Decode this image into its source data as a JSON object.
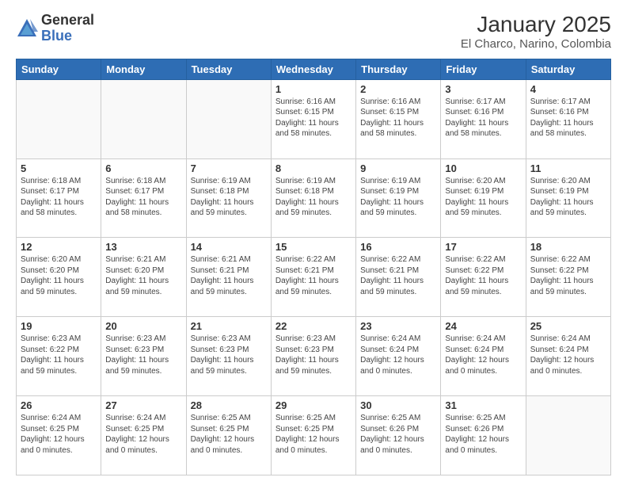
{
  "logo": {
    "general": "General",
    "blue": "Blue"
  },
  "title": "January 2025",
  "subtitle": "El Charco, Narino, Colombia",
  "weekdays": [
    "Sunday",
    "Monday",
    "Tuesday",
    "Wednesday",
    "Thursday",
    "Friday",
    "Saturday"
  ],
  "weeks": [
    [
      {
        "day": "",
        "sunrise": "",
        "sunset": "",
        "daylight": ""
      },
      {
        "day": "",
        "sunrise": "",
        "sunset": "",
        "daylight": ""
      },
      {
        "day": "",
        "sunrise": "",
        "sunset": "",
        "daylight": ""
      },
      {
        "day": "1",
        "sunrise": "Sunrise: 6:16 AM",
        "sunset": "Sunset: 6:15 PM",
        "daylight": "Daylight: 11 hours and 58 minutes."
      },
      {
        "day": "2",
        "sunrise": "Sunrise: 6:16 AM",
        "sunset": "Sunset: 6:15 PM",
        "daylight": "Daylight: 11 hours and 58 minutes."
      },
      {
        "day": "3",
        "sunrise": "Sunrise: 6:17 AM",
        "sunset": "Sunset: 6:16 PM",
        "daylight": "Daylight: 11 hours and 58 minutes."
      },
      {
        "day": "4",
        "sunrise": "Sunrise: 6:17 AM",
        "sunset": "Sunset: 6:16 PM",
        "daylight": "Daylight: 11 hours and 58 minutes."
      }
    ],
    [
      {
        "day": "5",
        "sunrise": "Sunrise: 6:18 AM",
        "sunset": "Sunset: 6:17 PM",
        "daylight": "Daylight: 11 hours and 58 minutes."
      },
      {
        "day": "6",
        "sunrise": "Sunrise: 6:18 AM",
        "sunset": "Sunset: 6:17 PM",
        "daylight": "Daylight: 11 hours and 58 minutes."
      },
      {
        "day": "7",
        "sunrise": "Sunrise: 6:19 AM",
        "sunset": "Sunset: 6:18 PM",
        "daylight": "Daylight: 11 hours and 59 minutes."
      },
      {
        "day": "8",
        "sunrise": "Sunrise: 6:19 AM",
        "sunset": "Sunset: 6:18 PM",
        "daylight": "Daylight: 11 hours and 59 minutes."
      },
      {
        "day": "9",
        "sunrise": "Sunrise: 6:19 AM",
        "sunset": "Sunset: 6:19 PM",
        "daylight": "Daylight: 11 hours and 59 minutes."
      },
      {
        "day": "10",
        "sunrise": "Sunrise: 6:20 AM",
        "sunset": "Sunset: 6:19 PM",
        "daylight": "Daylight: 11 hours and 59 minutes."
      },
      {
        "day": "11",
        "sunrise": "Sunrise: 6:20 AM",
        "sunset": "Sunset: 6:19 PM",
        "daylight": "Daylight: 11 hours and 59 minutes."
      }
    ],
    [
      {
        "day": "12",
        "sunrise": "Sunrise: 6:20 AM",
        "sunset": "Sunset: 6:20 PM",
        "daylight": "Daylight: 11 hours and 59 minutes."
      },
      {
        "day": "13",
        "sunrise": "Sunrise: 6:21 AM",
        "sunset": "Sunset: 6:20 PM",
        "daylight": "Daylight: 11 hours and 59 minutes."
      },
      {
        "day": "14",
        "sunrise": "Sunrise: 6:21 AM",
        "sunset": "Sunset: 6:21 PM",
        "daylight": "Daylight: 11 hours and 59 minutes."
      },
      {
        "day": "15",
        "sunrise": "Sunrise: 6:22 AM",
        "sunset": "Sunset: 6:21 PM",
        "daylight": "Daylight: 11 hours and 59 minutes."
      },
      {
        "day": "16",
        "sunrise": "Sunrise: 6:22 AM",
        "sunset": "Sunset: 6:21 PM",
        "daylight": "Daylight: 11 hours and 59 minutes."
      },
      {
        "day": "17",
        "sunrise": "Sunrise: 6:22 AM",
        "sunset": "Sunset: 6:22 PM",
        "daylight": "Daylight: 11 hours and 59 minutes."
      },
      {
        "day": "18",
        "sunrise": "Sunrise: 6:22 AM",
        "sunset": "Sunset: 6:22 PM",
        "daylight": "Daylight: 11 hours and 59 minutes."
      }
    ],
    [
      {
        "day": "19",
        "sunrise": "Sunrise: 6:23 AM",
        "sunset": "Sunset: 6:22 PM",
        "daylight": "Daylight: 11 hours and 59 minutes."
      },
      {
        "day": "20",
        "sunrise": "Sunrise: 6:23 AM",
        "sunset": "Sunset: 6:23 PM",
        "daylight": "Daylight: 11 hours and 59 minutes."
      },
      {
        "day": "21",
        "sunrise": "Sunrise: 6:23 AM",
        "sunset": "Sunset: 6:23 PM",
        "daylight": "Daylight: 11 hours and 59 minutes."
      },
      {
        "day": "22",
        "sunrise": "Sunrise: 6:23 AM",
        "sunset": "Sunset: 6:23 PM",
        "daylight": "Daylight: 11 hours and 59 minutes."
      },
      {
        "day": "23",
        "sunrise": "Sunrise: 6:24 AM",
        "sunset": "Sunset: 6:24 PM",
        "daylight": "Daylight: 12 hours and 0 minutes."
      },
      {
        "day": "24",
        "sunrise": "Sunrise: 6:24 AM",
        "sunset": "Sunset: 6:24 PM",
        "daylight": "Daylight: 12 hours and 0 minutes."
      },
      {
        "day": "25",
        "sunrise": "Sunrise: 6:24 AM",
        "sunset": "Sunset: 6:24 PM",
        "daylight": "Daylight: 12 hours and 0 minutes."
      }
    ],
    [
      {
        "day": "26",
        "sunrise": "Sunrise: 6:24 AM",
        "sunset": "Sunset: 6:25 PM",
        "daylight": "Daylight: 12 hours and 0 minutes."
      },
      {
        "day": "27",
        "sunrise": "Sunrise: 6:24 AM",
        "sunset": "Sunset: 6:25 PM",
        "daylight": "Daylight: 12 hours and 0 minutes."
      },
      {
        "day": "28",
        "sunrise": "Sunrise: 6:25 AM",
        "sunset": "Sunset: 6:25 PM",
        "daylight": "Daylight: 12 hours and 0 minutes."
      },
      {
        "day": "29",
        "sunrise": "Sunrise: 6:25 AM",
        "sunset": "Sunset: 6:25 PM",
        "daylight": "Daylight: 12 hours and 0 minutes."
      },
      {
        "day": "30",
        "sunrise": "Sunrise: 6:25 AM",
        "sunset": "Sunset: 6:26 PM",
        "daylight": "Daylight: 12 hours and 0 minutes."
      },
      {
        "day": "31",
        "sunrise": "Sunrise: 6:25 AM",
        "sunset": "Sunset: 6:26 PM",
        "daylight": "Daylight: 12 hours and 0 minutes."
      },
      {
        "day": "",
        "sunrise": "",
        "sunset": "",
        "daylight": ""
      }
    ]
  ]
}
